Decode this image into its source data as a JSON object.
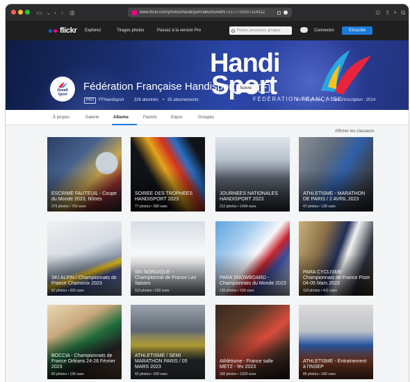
{
  "browser": {
    "url": "www.flickr.com/photos/handisport/albums/with/72177720307214112"
  },
  "topbar": {
    "logo": "flickr",
    "nav": [
      "Explorez",
      "Tirages photos",
      "Passez à la version Pro"
    ],
    "search_placeholder": "Photos, personnes, groupes",
    "signin": "Connexion",
    "signup": "S'inscrire"
  },
  "banner": {
    "logo_line1": "Handi",
    "logo_line2": "Sport",
    "logo_sub": "FÉDÉRATION FRANÇAISE",
    "avatar_text1": "Handi",
    "avatar_text2": "Sport"
  },
  "profile": {
    "name": "Fédération Française Handisport",
    "follow_label": "Suivre",
    "more_label": "•••",
    "pro_badge": "PRO",
    "username": "FFHandisport",
    "followers": "326 abonnés",
    "following": "35 abonnements",
    "photos": "40 785 photos",
    "joined": "Date d'inscription : 2014"
  },
  "tabs": [
    "À propos",
    "Galerie",
    "Albums",
    "Favoris",
    "Expos",
    "Groupes"
  ],
  "active_tab": "Albums",
  "showcases_label": "Afficher les classeurs",
  "albums": [
    {
      "title": "ESCRIME FAUTEUIL - Coupe du Monde 2023, Nîmes",
      "meta": "273 photos • 753 vues"
    },
    {
      "title": "SOIREE DES TROPHEES HANDISPORT 2023",
      "meta": "77 photos • 280 vues"
    },
    {
      "title": "JOURNEES NATIONALES HANDISPORT 2023",
      "meta": "212 photos • 1404 vues"
    },
    {
      "title": "ATHLETISME - MARATHON DE PARIS / 2 AVRIL 2023",
      "meta": "47 photos • 128 vues"
    },
    {
      "title": "SKI ALPIN / Championnats de France Chamonix 2023",
      "meta": "62 photos • 269 vues"
    },
    {
      "title": "SKI NORDIQUE - Championnat de France Les Saisies",
      "meta": "113 photos • 230 vues"
    },
    {
      "title": "PARA SNOWBOARD - Championnats du Monde 2023",
      "meta": "136 photos • 168 vues"
    },
    {
      "title": "PARA CYCLISME - Championnats de France Piste 04-05 Mars 2023",
      "meta": "118 photos • 411 vues"
    },
    {
      "title": "BOCCIA - Championnats de France Orléans 24-26 Février 2023",
      "meta": "83 photos • 136 vues"
    },
    {
      "title": "ATHLETISME / SEMI MARATHON PARIS / 05 MARS 2023",
      "meta": "42 photos • 109 vues"
    },
    {
      "title": "Athlétisme - France salle METZ - fév 2023",
      "meta": "330 photos • 1029 vues"
    },
    {
      "title": "ATHLETISME - Entrainement à l'INSEP",
      "meta": "85 photos • 160 vues"
    }
  ],
  "colors": {
    "accent": "#1c7ad8",
    "flickr_blue": "#0063dc",
    "flickr_pink": "#ff0084",
    "banner_blue": "#2b46a8"
  }
}
